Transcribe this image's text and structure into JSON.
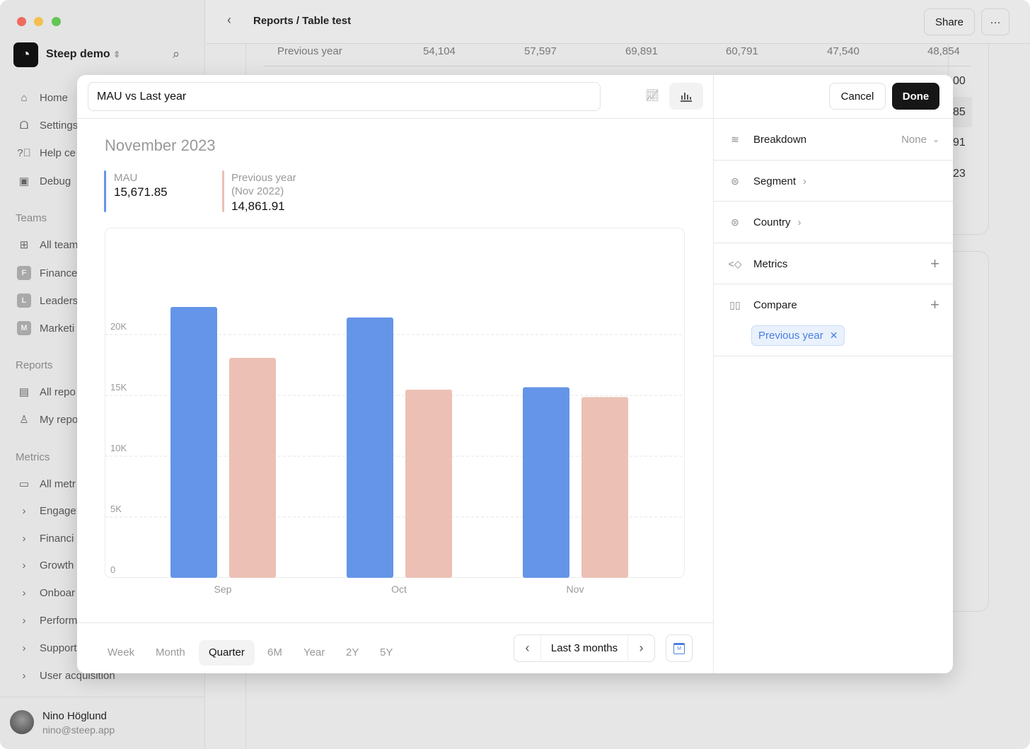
{
  "window": {
    "traffic_lights": [
      "#ee6a5f",
      "#f5be4f",
      "#62c655"
    ]
  },
  "sidebar": {
    "workspace": "Steep demo",
    "nav": [
      {
        "label": "Home",
        "icon": "home-icon"
      },
      {
        "label": "Settings",
        "icon": "settings-icon"
      },
      {
        "label": "Help ce",
        "icon": "help-icon"
      },
      {
        "label": "Debug",
        "icon": "chip-icon"
      }
    ],
    "teams_title": "Teams",
    "teams": [
      {
        "label": "All team",
        "badge": ""
      },
      {
        "label": "Finance",
        "badge": "F"
      },
      {
        "label": "Leaders",
        "badge": "L"
      },
      {
        "label": "Marketi",
        "badge": "M"
      }
    ],
    "reports_title": "Reports",
    "reports": [
      {
        "label": "All repo"
      },
      {
        "label": "My repo"
      }
    ],
    "metrics_title": "Metrics",
    "metrics": [
      {
        "label": "All metr"
      },
      {
        "label": "Engage"
      },
      {
        "label": "Financi"
      },
      {
        "label": "Growth"
      },
      {
        "label": "Onboar"
      },
      {
        "label": "Perform"
      },
      {
        "label": "Support"
      },
      {
        "label": "User acquisition"
      }
    ],
    "user": {
      "name": "Nino Höglund",
      "email": "nino@steep.app"
    }
  },
  "topbar": {
    "breadcrumb": "Reports / Table test",
    "share": "Share",
    "more": "···"
  },
  "background_table": {
    "row_label": "Previous year",
    "values": [
      "54,104",
      "57,597",
      "69,891",
      "60,791",
      "47,540",
      "48,854"
    ],
    "edge_fragments": [
      "00",
      "85",
      "91",
      "23"
    ]
  },
  "modal": {
    "title_value": "MAU vs Last year",
    "cancel": "Cancel",
    "done": "Done",
    "period_title": "November 2023",
    "legend": [
      {
        "label": "MAU",
        "sub": "",
        "value": "15,671.85",
        "color": "#6595e8"
      },
      {
        "label": "Previous year",
        "sub": "(Nov 2022)",
        "value": "14,861.91",
        "color": "#ecc0b5"
      }
    ],
    "periods": [
      "Week",
      "Month",
      "Quarter",
      "6M",
      "Year",
      "2Y",
      "5Y"
    ],
    "selected_period": "Quarter",
    "range": "Last 3 months",
    "calendar_letter": "M"
  },
  "panel": {
    "breakdown": {
      "label": "Breakdown",
      "value": "None"
    },
    "segment": "Segment",
    "country": "Country",
    "metrics": "Metrics",
    "compare": "Compare",
    "compare_chip": "Previous year"
  },
  "chart_data": {
    "type": "bar",
    "categories": [
      "Sep",
      "Oct",
      "Nov"
    ],
    "series": [
      {
        "name": "MAU",
        "color": "#6595e8",
        "values": [
          22270,
          21400,
          15671.85
        ]
      },
      {
        "name": "Previous year",
        "color": "#ecc0b5",
        "values": [
          18080,
          15470,
          14861.91
        ]
      }
    ],
    "yticks": [
      {
        "v": 0,
        "label": "0"
      },
      {
        "v": 5000,
        "label": "5K"
      },
      {
        "v": 10000,
        "label": "10K"
      },
      {
        "v": 15000,
        "label": "15K"
      },
      {
        "v": 20000,
        "label": "20K"
      }
    ],
    "ylim": [
      0,
      28800
    ],
    "grid": true
  }
}
